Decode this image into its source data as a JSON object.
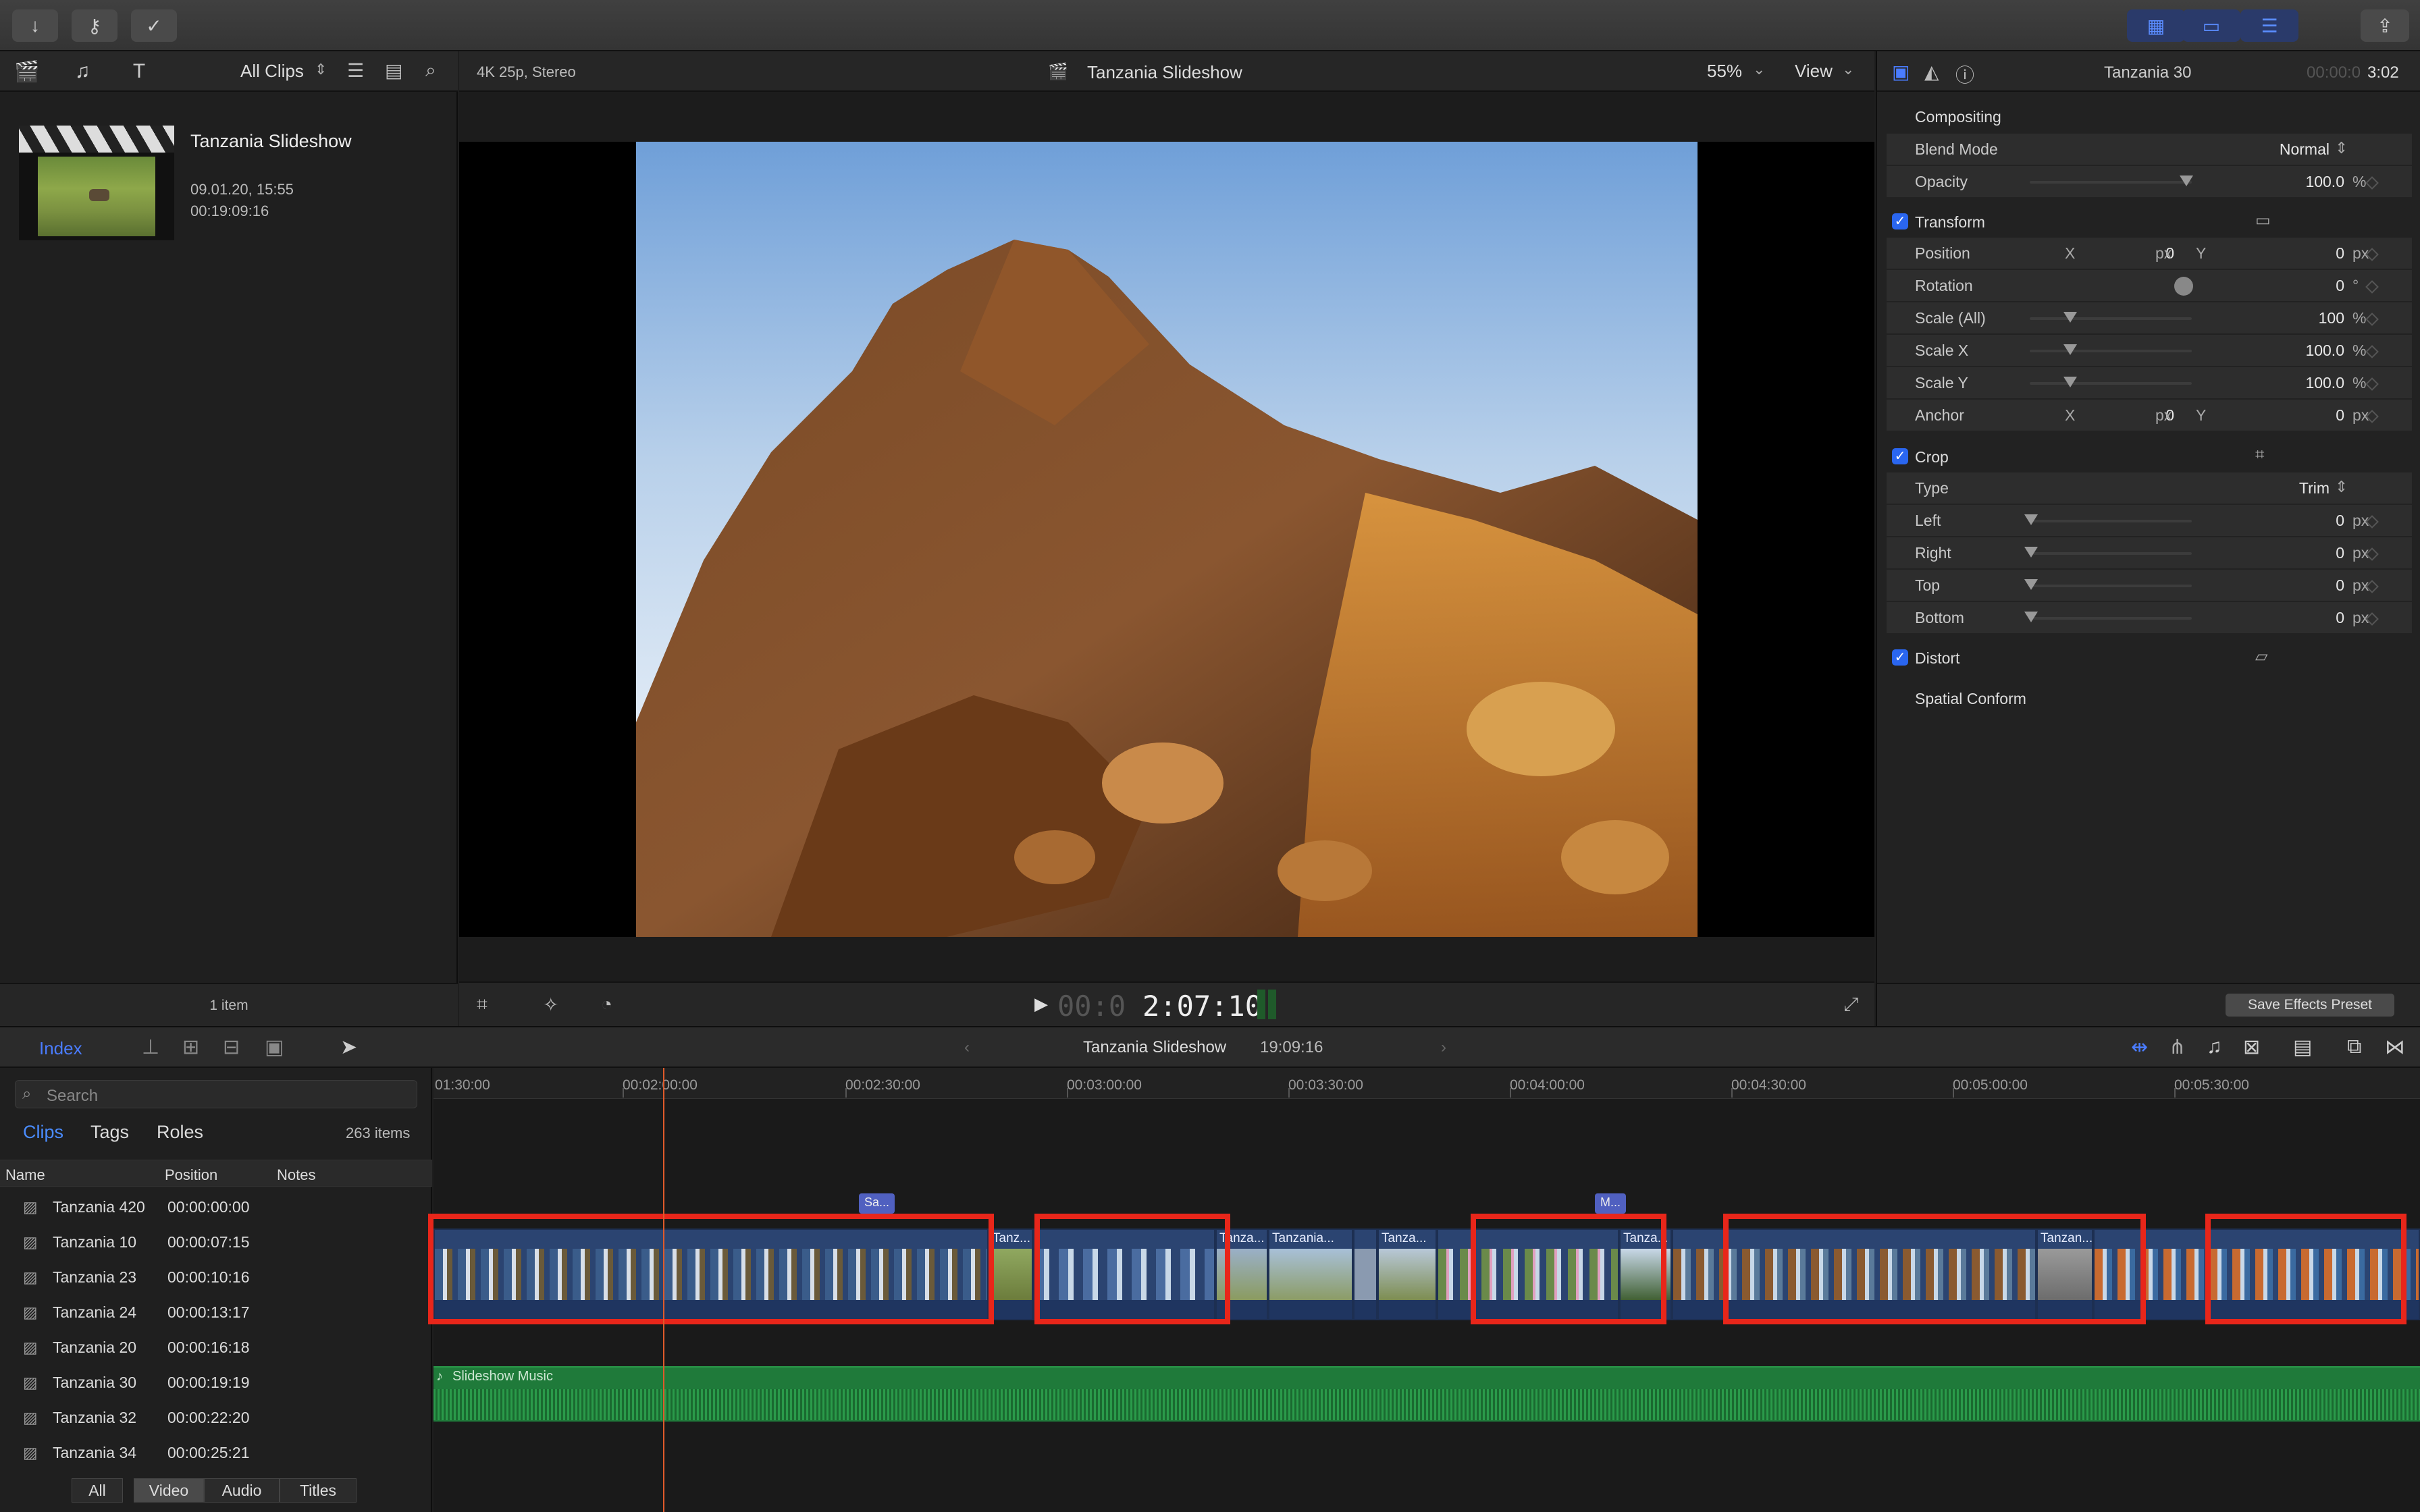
{
  "toolbar": {
    "import_icon": "arrow-down-icon",
    "keywords_icon": "key-icon",
    "check_icon": "check-circle-icon",
    "layout_buttons": [
      "grid-icon",
      "timeline-icon",
      "inspector-icon"
    ],
    "share_icon": "share-icon"
  },
  "browser": {
    "filter": "All Clips",
    "project": {
      "name": "Tanzania Slideshow",
      "date": "09.01.20, 15:55",
      "duration": "00:19:09:16"
    },
    "footer": "1 item"
  },
  "viewer": {
    "format": "4K 25p, Stereo",
    "title": "Tanzania Slideshow",
    "zoom": "55%",
    "view": "View",
    "timecode_dim": "00:0",
    "timecode_bright": "2:07:10"
  },
  "inspector": {
    "clip_name": "Tanzania 30",
    "duration_dim": "00:00:0",
    "duration_bright": "3:02",
    "compositing": "Compositing",
    "blend_mode_label": "Blend Mode",
    "blend_mode_value": "Normal",
    "opacity_label": "Opacity",
    "opacity_value": "100.0",
    "pct": "%",
    "transform": "Transform",
    "position_label": "Position",
    "rotation_label": "Rotation",
    "scale_all_label": "Scale (All)",
    "scale_x_label": "Scale X",
    "scale_y_label": "Scale Y",
    "anchor_label": "Anchor",
    "x": "X",
    "y": "Y",
    "px": "px",
    "deg": "°",
    "zero": "0",
    "scale_all_value": "100",
    "scale_x_value": "100.0",
    "scale_y_value": "100.0",
    "crop": "Crop",
    "type_label": "Type",
    "type_value": "Trim",
    "left_label": "Left",
    "right_label": "Right",
    "top_label": "Top",
    "bottom_label": "Bottom",
    "distort": "Distort",
    "spatial_conform": "Spatial Conform",
    "save_preset": "Save Effects Preset"
  },
  "timeline": {
    "index_label": "Index",
    "project_title": "Tanzania Slideshow",
    "project_duration": "19:09:16",
    "ruler": [
      "01:30:00",
      "00:02:00:00",
      "00:02:30:00",
      "00:03:00:00",
      "00:03:30:00",
      "00:04:00:00",
      "00:04:30:00",
      "00:05:00:00",
      "00:05:30:00"
    ],
    "music_label": "Slideshow Music",
    "markers": [
      "Sa...",
      "M..."
    ],
    "clip_labels": [
      "Tanz...",
      "Tanza...",
      "Tanzania...",
      "Tanza...",
      "Tanza...",
      "Tanzan..."
    ]
  },
  "index": {
    "search_placeholder": "Search",
    "tabs": [
      "Clips",
      "Tags",
      "Roles"
    ],
    "count": "263 items",
    "columns": [
      "Name",
      "Position",
      "Notes"
    ],
    "rows": [
      {
        "name": "Tanzania 420",
        "pos": "00:00:00:00"
      },
      {
        "name": "Tanzania 10",
        "pos": "00:00:07:15"
      },
      {
        "name": "Tanzania 23",
        "pos": "00:00:10:16"
      },
      {
        "name": "Tanzania 24",
        "pos": "00:00:13:17"
      },
      {
        "name": "Tanzania 20",
        "pos": "00:00:16:18"
      },
      {
        "name": "Tanzania 30",
        "pos": "00:00:19:19"
      },
      {
        "name": "Tanzania 32",
        "pos": "00:00:22:20"
      },
      {
        "name": "Tanzania 34",
        "pos": "00:00:25:21"
      }
    ],
    "bottom_tabs": [
      "All",
      "Video",
      "Audio",
      "Titles"
    ]
  }
}
